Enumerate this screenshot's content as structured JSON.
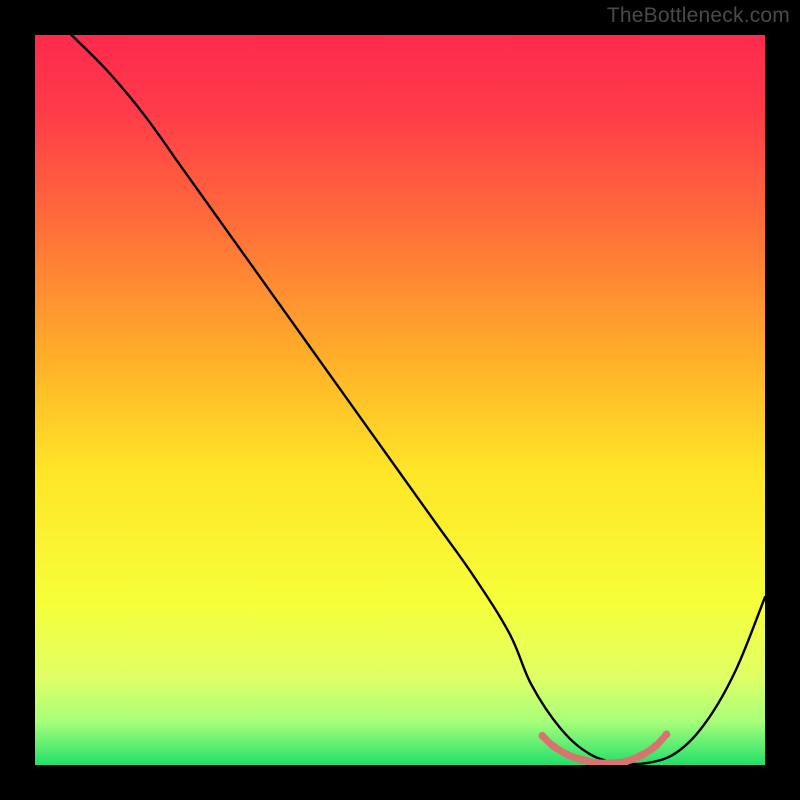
{
  "watermark": "TheBottleneck.com",
  "chart_data": {
    "type": "line",
    "title": "",
    "xlabel": "",
    "ylabel": "",
    "xlim": [
      0,
      100
    ],
    "ylim": [
      0,
      100
    ],
    "series": [
      {
        "name": "curve",
        "color": "#000000",
        "x": [
          5,
          10,
          15,
          20,
          25,
          30,
          35,
          40,
          45,
          50,
          55,
          60,
          65,
          68,
          72,
          76,
          80,
          84,
          88,
          92,
          96,
          100
        ],
        "y": [
          100,
          95,
          89,
          82,
          75,
          68,
          61,
          54,
          47,
          40,
          33,
          26,
          18,
          11,
          5,
          1.5,
          0.3,
          0.3,
          1.8,
          6,
          13,
          23
        ]
      },
      {
        "name": "bottom-highlight",
        "color": "#d9736f",
        "x": [
          69.5,
          71,
          73,
          75,
          77,
          79,
          81,
          83,
          85,
          86.5
        ],
        "y": [
          4.0,
          2.6,
          1.4,
          0.7,
          0.3,
          0.3,
          0.5,
          1.3,
          2.6,
          4.2
        ]
      }
    ],
    "gradient": {
      "stops": [
        {
          "offset": 0,
          "color": "#ff2a4d"
        },
        {
          "offset": 0.1,
          "color": "#ff3a4a"
        },
        {
          "offset": 0.25,
          "color": "#ff6a3a"
        },
        {
          "offset": 0.45,
          "color": "#ffb229"
        },
        {
          "offset": 0.6,
          "color": "#ffe627"
        },
        {
          "offset": 0.78,
          "color": "#f6ff3a"
        },
        {
          "offset": 0.88,
          "color": "#e0ff66"
        },
        {
          "offset": 0.94,
          "color": "#a8ff7a"
        },
        {
          "offset": 1.0,
          "color": "#22e06a"
        }
      ]
    }
  }
}
